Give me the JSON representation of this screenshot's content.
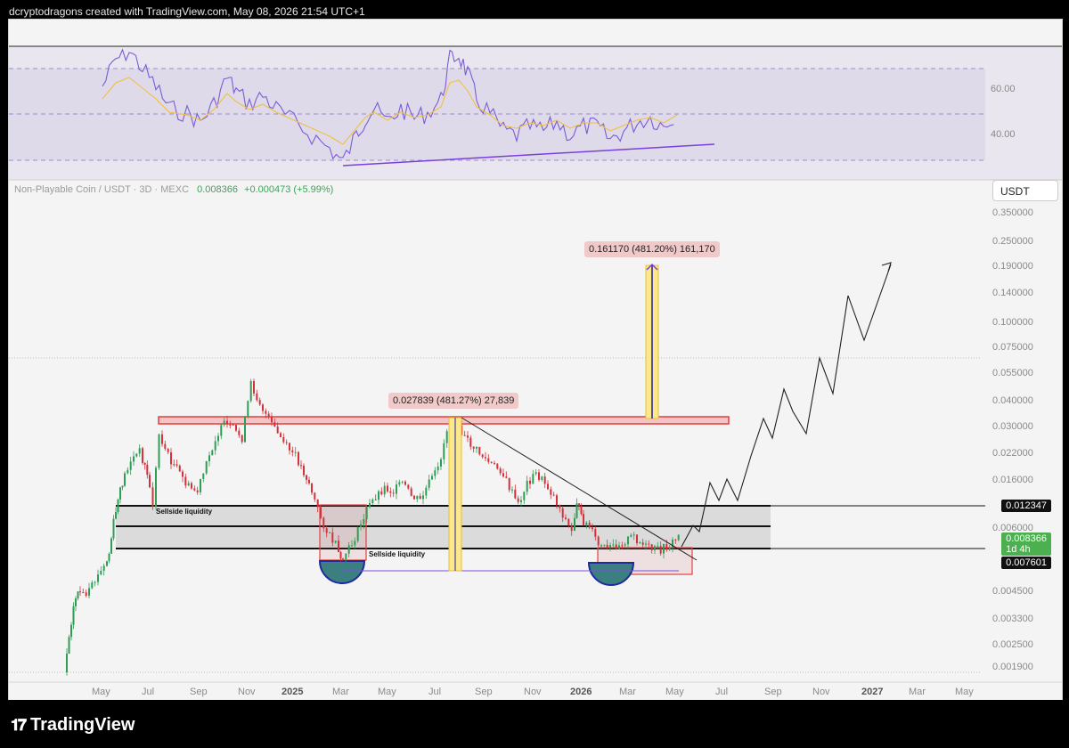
{
  "header": {
    "credit": "dcryptodragons created with TradingView.com, May 08, 2026 21:54 UTC+1"
  },
  "rsi_panel": {
    "levels": [
      "60.00",
      "40.00"
    ],
    "line_color": "#7b5cd6",
    "ma_color": "#f0c040"
  },
  "symbol": {
    "name": "Non-Playable Coin / USDT · 3D · MEXC",
    "price": "0.008366",
    "change": "+0.000473 (+5.99%)"
  },
  "currency_button": "USDT",
  "price_axis": [
    "0.350000",
    "0.250000",
    "0.190000",
    "0.140000",
    "0.100000",
    "0.075000",
    "0.055000",
    "0.040000",
    "0.030000",
    "0.022000",
    "0.016000",
    "0.006000",
    "0.004500",
    "0.003300",
    "0.002500",
    "0.001900"
  ],
  "price_tags": {
    "upper_level": "0.012347",
    "current_price": "0.008366",
    "countdown": "1d 4h",
    "lower_level": "0.007601"
  },
  "time_axis": [
    "May",
    "Jul",
    "Sep",
    "Nov",
    "2025",
    "Mar",
    "May",
    "Jul",
    "Sep",
    "Nov",
    "2026",
    "Mar",
    "May",
    "Jul",
    "Sep",
    "Nov",
    "2027",
    "Mar",
    "May"
  ],
  "annotations": {
    "sellside_1": "Sellside liquidity",
    "sellside_2": "Sellside liquidity",
    "measure_small": "0.027839 (481.27%) 27,839",
    "measure_big": "0.161170 (481.20%) 161,170"
  },
  "colors": {
    "up_candle": "#2e9e55",
    "down_candle": "#d6303a",
    "resistance_box": "#e04040",
    "measure_fill": "#fbe88a",
    "range_fill": "#d8d8d8",
    "cup_fill": "#3b7f80",
    "cup_stroke": "#1c2c9c"
  },
  "footer": {
    "brand": "TradingView"
  }
}
